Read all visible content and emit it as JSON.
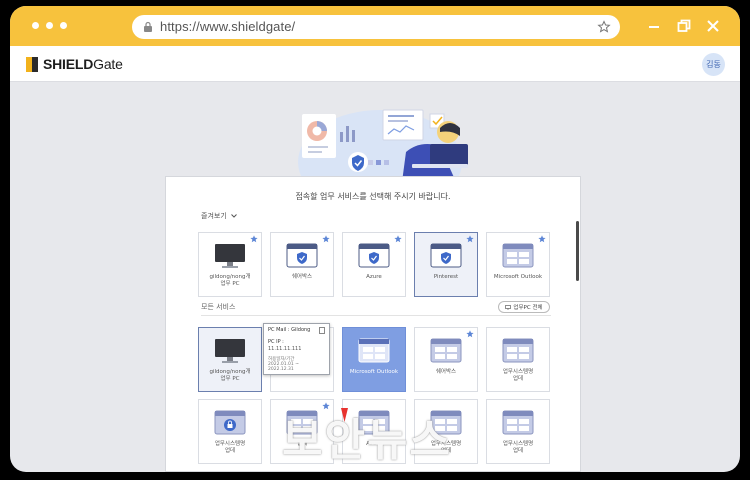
{
  "browser": {
    "url": "https://www.shieldgate/"
  },
  "app": {
    "logo_bold": "SHIELD",
    "logo_regular": "Gate",
    "user_initials": "김동"
  },
  "panel": {
    "title": "접속할 업무 서비스를 선택해 주시기 바랍니다.",
    "sort_label": "즐겨보기",
    "section_all": "모든 서비스",
    "pc_button": "업무PC 전체"
  },
  "favorites": [
    {
      "label": "gildong/nong개\n업무 PC",
      "icon": "monitor-icon"
    },
    {
      "label": "쉐어박스",
      "icon": "shield-window-icon"
    },
    {
      "label": "Azure",
      "icon": "shield-window-icon"
    },
    {
      "label": "Pinterest",
      "icon": "shield-window-icon"
    },
    {
      "label": "Microsoft Outlook",
      "icon": "grid-window-icon"
    }
  ],
  "services_row1": [
    {
      "label": "gildong/nong개\n업무 PC",
      "icon": "monitor-icon"
    },
    {
      "label": "업무",
      "icon": "grid-window-icon"
    },
    {
      "label": "Microsoft Outlook",
      "icon": "grid-window-icon"
    },
    {
      "label": "쉐어박스",
      "icon": "grid-window-icon"
    },
    {
      "label": "업무시스템명\n업데",
      "icon": "grid-window-icon"
    }
  ],
  "services_row2": [
    {
      "label": "업무시스템명\n업데",
      "icon": "lock-window-icon"
    },
    {
      "label": "업데",
      "icon": "grid-window-icon"
    },
    {
      "label": "Azure",
      "icon": "grid-window-icon"
    },
    {
      "label": "업무시스템명\n업데",
      "icon": "grid-window-icon"
    },
    {
      "label": "업무시스템명\n업데",
      "icon": "grid-window-icon"
    }
  ],
  "tooltip": {
    "title": "PC Mail : Gildong",
    "ip_label": "PC IP :",
    "ip_value": "11.11.11.111",
    "period_label": "허용일자/기간",
    "period_value": "2022.01.01 ~ 2022.12.31"
  },
  "watermark": "보안뉴스",
  "colors": {
    "titlebar": "#f7c23d",
    "accent_blue": "#7f9ee2",
    "star": "#5d86d6",
    "watermark_dot": "#e8322f"
  }
}
